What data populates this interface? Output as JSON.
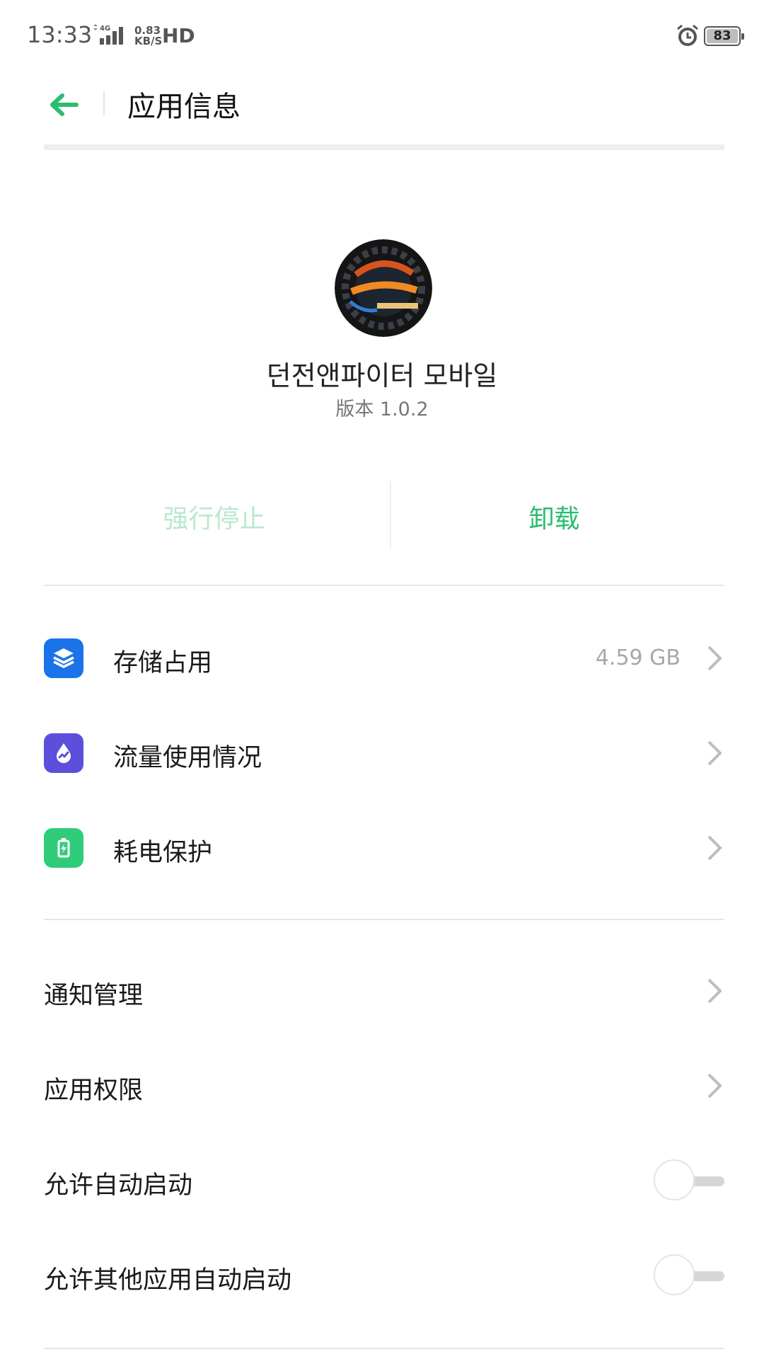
{
  "status_bar": {
    "time": "13:33",
    "network": "4G",
    "speed_top": "0.83",
    "speed_bottom": "KB/S",
    "hd": "HD",
    "battery": "83"
  },
  "header": {
    "title": "应用信息"
  },
  "app": {
    "name": "던전앤파이터 모바일",
    "version": "版本 1.0.2"
  },
  "actions": {
    "force_stop": "强行停止",
    "uninstall": "卸载"
  },
  "rows_with_icons": [
    {
      "label": "存储占用",
      "value": "4.59 GB",
      "icon": "storage-layers-icon",
      "color": "#1a73e8"
    },
    {
      "label": "流量使用情况",
      "value": "",
      "icon": "data-usage-icon",
      "color": "#5b4fdb"
    },
    {
      "label": "耗电保护",
      "value": "",
      "icon": "battery-protect-icon",
      "color": "#2fcc7a"
    }
  ],
  "rows_plain": [
    {
      "label": "通知管理"
    },
    {
      "label": "应用权限"
    }
  ],
  "toggles": [
    {
      "label": "允许自动启动",
      "state": "off"
    },
    {
      "label": "允许其他应用自动启动",
      "state": "off"
    }
  ],
  "colors": {
    "accent": "#2bbd6e",
    "accent_disabled": "#b9e8cf"
  }
}
